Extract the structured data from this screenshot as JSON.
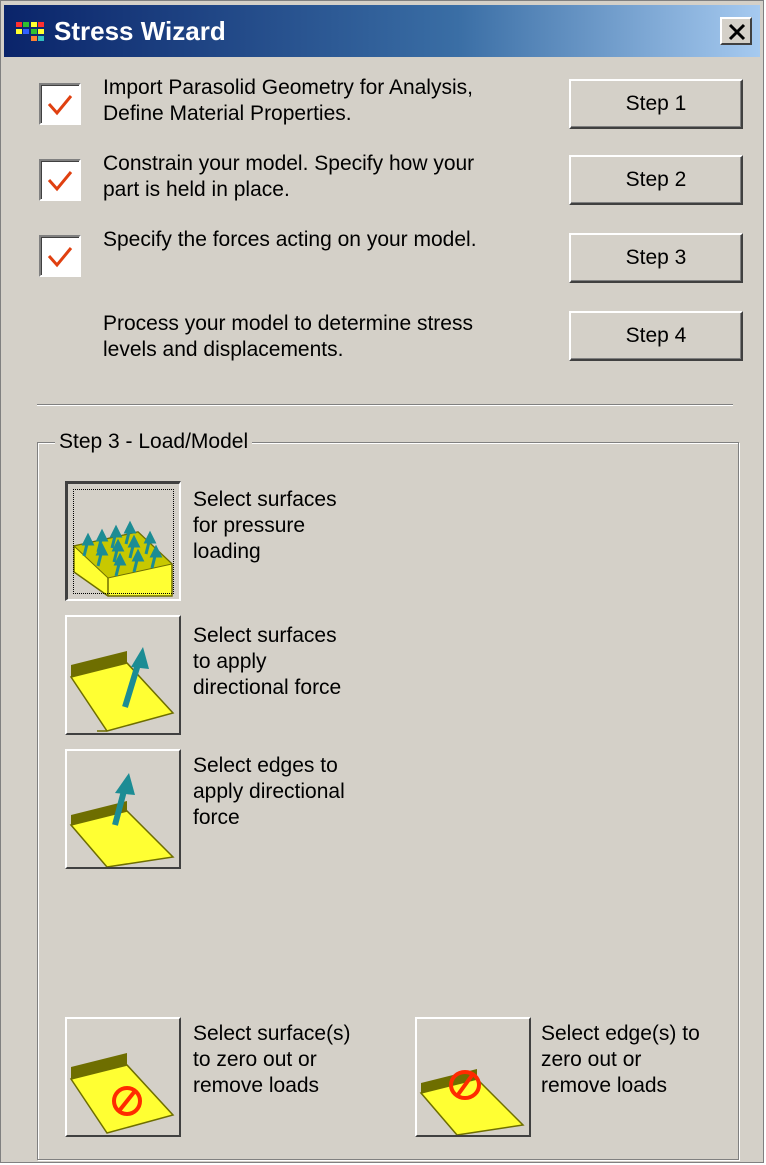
{
  "window": {
    "title": "Stress Wizard"
  },
  "steps": [
    {
      "checked": true,
      "description_lines": [
        "Import Parasolid Geometry for Analysis,",
        "Define Material Properties."
      ],
      "button_label": "Step 1"
    },
    {
      "checked": true,
      "description_lines": [
        "Constrain your model. Specify how your",
        "part is held in place."
      ],
      "button_label": "Step 2"
    },
    {
      "checked": true,
      "description_lines": [
        "Specify the forces acting on your model."
      ],
      "button_label": "Step 3"
    },
    {
      "checked": false,
      "description_lines": [
        "Process your model to determine stress",
        "levels and displacements."
      ],
      "button_label": "Step 4"
    }
  ],
  "load_group": {
    "legend": "Step 3 - Load/Model",
    "tools": [
      {
        "icon": "pressure-load-icon",
        "label_lines": [
          "Select surfaces",
          "for pressure",
          "loading"
        ],
        "pressed": true
      },
      {
        "icon": "surface-force-icon",
        "label_lines": [
          "Select surfaces",
          "to apply",
          "directional force"
        ],
        "pressed": false
      },
      {
        "icon": "edge-force-icon",
        "label_lines": [
          "Select edges to",
          "apply directional",
          "force"
        ],
        "pressed": false
      },
      {
        "icon": "remove-surface-load-icon",
        "label_lines": [
          "Select surface(s)",
          "to zero out or",
          "remove loads"
        ],
        "pressed": false
      },
      {
        "icon": "remove-edge-load-icon",
        "label_lines": [
          "Select edge(s) to",
          "zero out or",
          "remove loads"
        ],
        "pressed": false
      }
    ]
  },
  "colors": {
    "face": "#d4d0c8",
    "title_start": "#0a246a",
    "title_end": "#a6caf0",
    "check_mark": "#e04010",
    "model_yellow": "#ffff33",
    "arrow_teal": "#1c8c94",
    "remove_symbol": "#ff2a00"
  }
}
